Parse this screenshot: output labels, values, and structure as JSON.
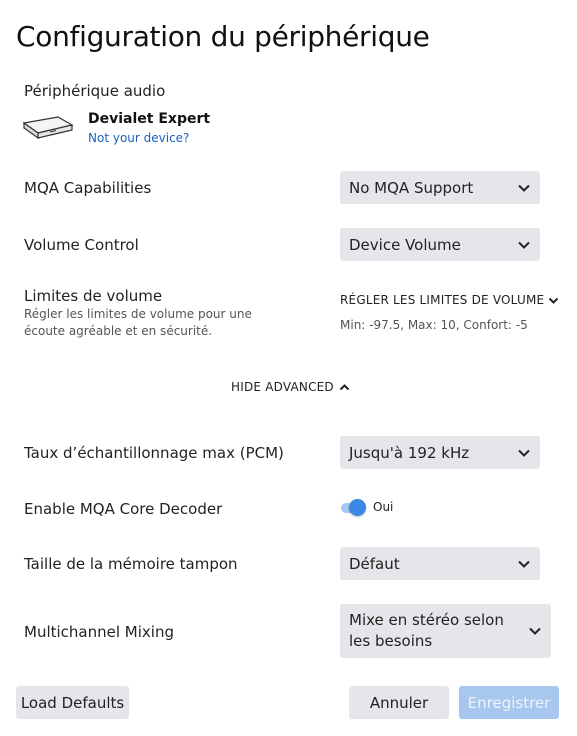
{
  "dialog": {
    "title": "Configuration du périphérique"
  },
  "audio_device": {
    "section_label": "Périphérique audio",
    "name": "Devialet Expert",
    "link": "Not your device?",
    "icon": "device-amplifier-icon"
  },
  "mqa_capabilities": {
    "label": "MQA Capabilities",
    "selected": "No MQA Support"
  },
  "volume_control": {
    "label": "Volume Control",
    "selected": "Device Volume"
  },
  "volume_limits": {
    "label": "Limites de volume",
    "description": "Régler les limites de volume pour une écoute agréable et en sécurité.",
    "action": "RÉGLER LES LIMITES DE VOLUME",
    "info": "Min: -97.5, Max: 10, Confort: -5"
  },
  "advanced": {
    "toggle_label": "HIDE ADVANCED"
  },
  "max_sample_rate": {
    "label": "Taux d’échantillonnage max (PCM)",
    "selected": "Jusqu'à 192 kHz"
  },
  "mqa_core_decoder": {
    "label": "Enable MQA Core Decoder",
    "state_label": "Oui",
    "enabled": true
  },
  "buffer_size": {
    "label": "Taille de la mémoire tampon",
    "selected": "Défaut"
  },
  "multichannel_mixing": {
    "label": "Multichannel Mixing",
    "selected": "Mixe en stéréo selon les besoins"
  },
  "footer": {
    "load_defaults": "Load Defaults",
    "cancel": "Annuler",
    "save": "Enregistrer"
  },
  "colors": {
    "accent": "#3c86e6",
    "link": "#1f5fbf",
    "control_bg": "#e4e6ea",
    "disabled_primary": "#a7c7ef"
  }
}
